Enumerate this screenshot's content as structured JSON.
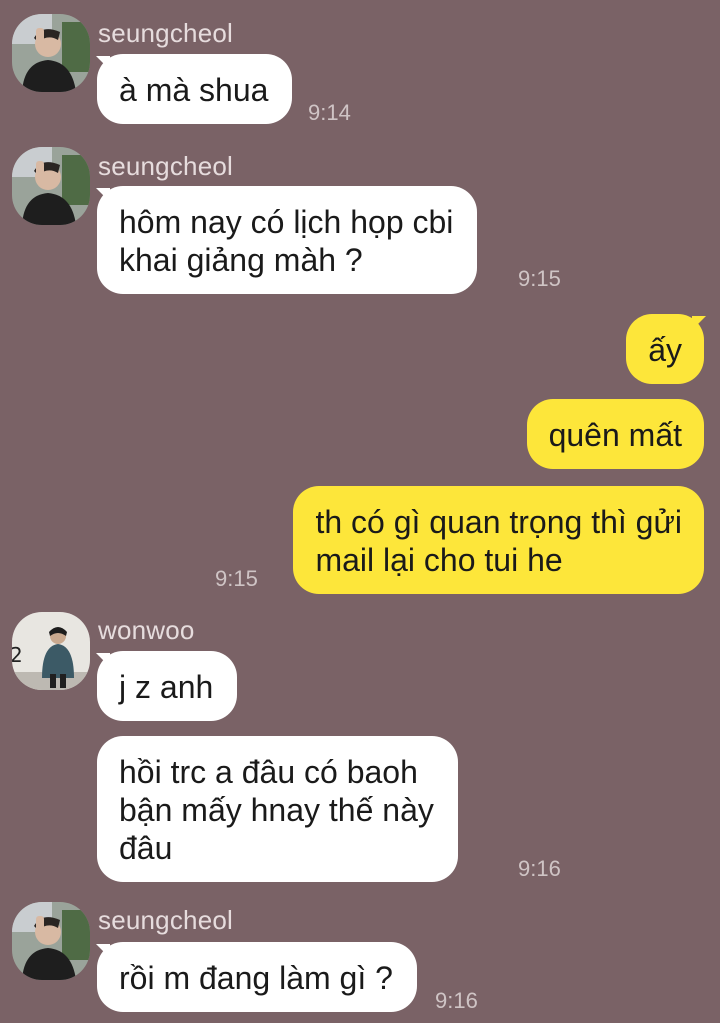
{
  "messages": [
    {
      "sender": "seungcheol",
      "text": "à mà shua",
      "time": "9:14"
    },
    {
      "sender": "seungcheol",
      "text": "hôm nay có lịch họp cbi\nkhai giảng màh ?",
      "time": "9:15"
    },
    {
      "text": "ấy"
    },
    {
      "text": "quên mất"
    },
    {
      "text": "th có gì quan trọng thì gửi\nmail lại cho tui he",
      "time": "9:15"
    },
    {
      "sender": "wonwoo",
      "text": "j z anh"
    },
    {
      "text": "hồi trc a đâu có baoh\nbận mấy hnay thế này\nđâu",
      "time": "9:16"
    },
    {
      "sender": "seungcheol",
      "text": "rồi m đang làm gì ?",
      "time": "9:16"
    }
  ],
  "colors": {
    "background": "#7a6266",
    "incoming_bubble": "#ffffff",
    "outgoing_bubble": "#fde63a",
    "sender_name": "#e6dcdd",
    "timestamp": "#cfc4c5"
  }
}
